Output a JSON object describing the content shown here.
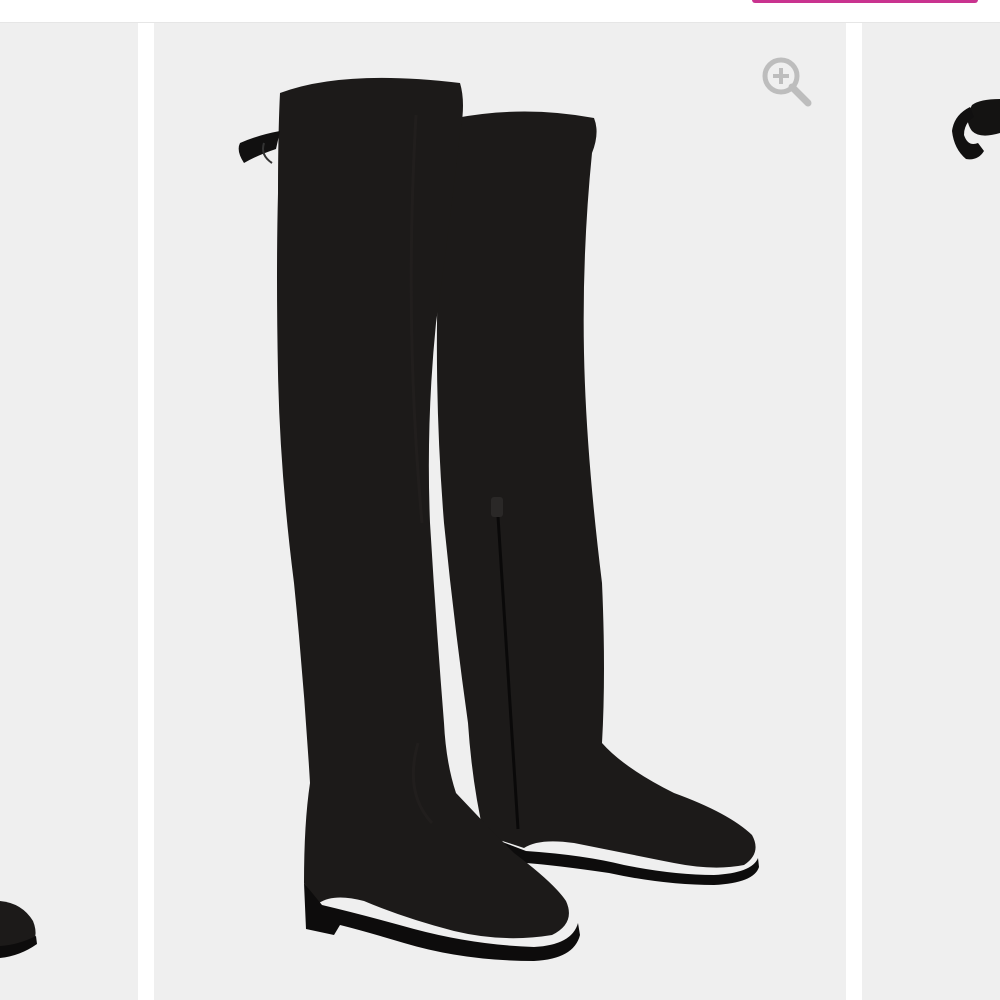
{
  "colors": {
    "accent": "#c9338f",
    "panel_background": "#efefef",
    "boot": "#1c1a19",
    "boot_shadow": "#121110",
    "sole": "#0d0c0c",
    "zoom_icon": "#bdbdbd"
  },
  "gallery": {
    "images": [
      {
        "icon": "boot-toe-thumbnail"
      },
      {
        "icon": "over-the-knee-boots-main-image"
      },
      {
        "icon": "boot-bow-thumbnail"
      }
    ],
    "zoom": {
      "icon": "zoom-in-icon"
    }
  }
}
